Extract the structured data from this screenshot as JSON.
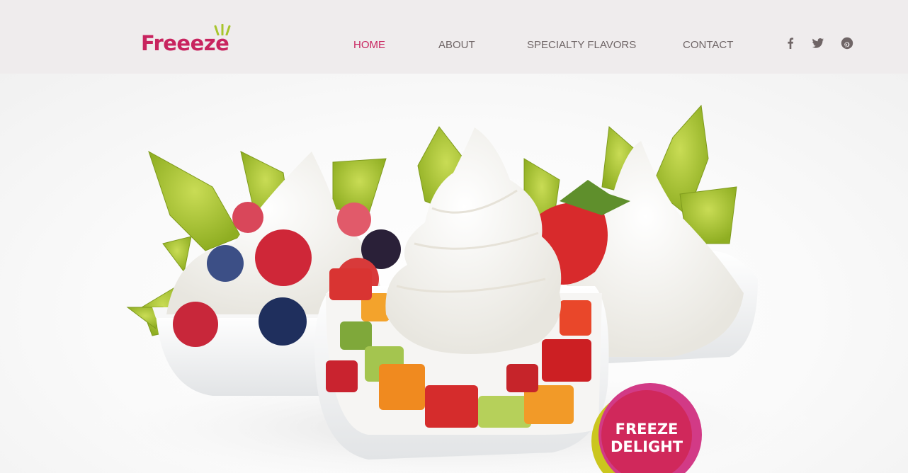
{
  "brand": {
    "name": "Freeeze",
    "color": "#c8245f",
    "leaf_color": "#a8c52d"
  },
  "nav": {
    "items": [
      {
        "label": "HOME",
        "active": true
      },
      {
        "label": "ABOUT",
        "active": false
      },
      {
        "label": "SPECIALTY FLAVORS",
        "active": false
      },
      {
        "label": "CONTACT",
        "active": false
      }
    ]
  },
  "social": {
    "items": [
      {
        "icon": "facebook-icon"
      },
      {
        "icon": "twitter-icon"
      },
      {
        "icon": "pinterest-icon"
      }
    ],
    "color": "#6f6566"
  },
  "hero": {
    "image_alt": "",
    "badge": {
      "line1": "FREEZE",
      "line2": "DELIGHT",
      "colors": [
        "#d0285b",
        "#d23a86",
        "#cbc61e"
      ]
    }
  }
}
